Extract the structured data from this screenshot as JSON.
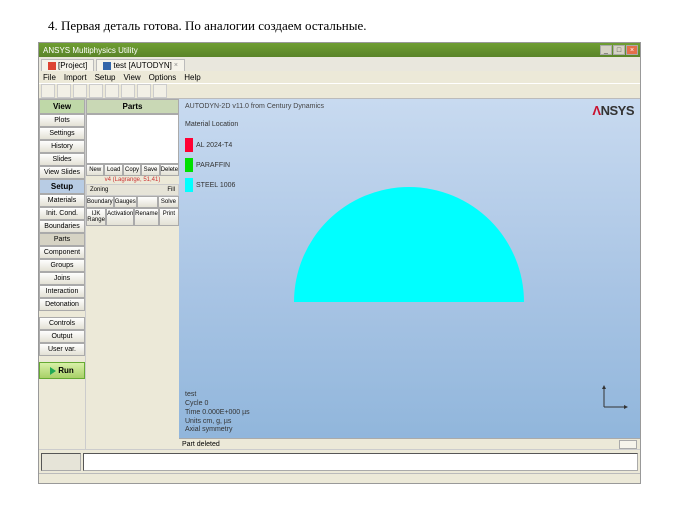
{
  "instruction": "4. Первая деталь готова. По аналогии создаем остальные.",
  "window": {
    "title": "ANSYS Multiphysics Utility",
    "tabs": [
      {
        "label": "[Project]"
      },
      {
        "label": "test [AUTODYN]"
      }
    ],
    "winbtns": {
      "min": "_",
      "max": "□",
      "close": "×"
    }
  },
  "menubar": [
    "File",
    "Import",
    "Setup",
    "View",
    "Options",
    "Help"
  ],
  "sidebar_left": {
    "view": "View",
    "view_items": [
      "Plots",
      "Settings",
      "History",
      "Slides",
      "View Slides"
    ],
    "setup": "Setup",
    "setup_items": [
      "Materials",
      "Init. Cond.",
      "Boundaries",
      "Parts",
      "Component",
      "Groups",
      "Joins",
      "Interaction",
      "Detonation"
    ],
    "bottom_items": [
      "Controls",
      "Output",
      "User var."
    ],
    "run": "Run"
  },
  "sidebar_mid": {
    "header": "Parts",
    "selected_label": "v4 (Lagrange, 51,41)",
    "row1": [
      "New",
      "Load",
      "Copy",
      "Save",
      "Delete"
    ],
    "sub": {
      "left": "Zoning",
      "right": "Fill"
    },
    "row2": [
      "Boundary",
      "Gauges",
      "",
      "Solve"
    ],
    "row3": [
      "IJK Range",
      "Activation",
      "Rename",
      "Print"
    ]
  },
  "viewport": {
    "title": "AUTODYN-2D v11.0 from Century Dynamics",
    "logo": "ANSYS",
    "legend_header": "Material Location",
    "legend": [
      {
        "label": "AL 2024-T4",
        "color": "#ff0033"
      },
      {
        "label": "PARAFFIN",
        "color": "#00e000"
      },
      {
        "label": "STEEL 1006",
        "color": "#00ffff"
      }
    ],
    "info": [
      "test",
      "Cycle 0",
      "Time 0.000E+000 µs",
      "Units cm, g, µs",
      "Axial symmetry"
    ],
    "status_msg": "Part deleted"
  }
}
